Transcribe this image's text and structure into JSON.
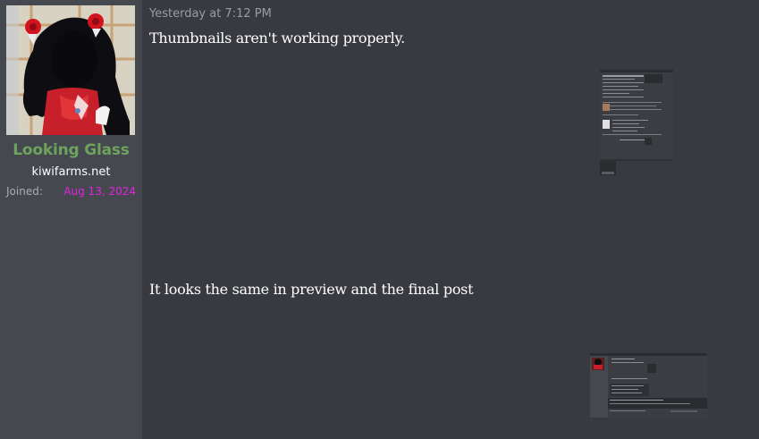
{
  "user": {
    "username": "Looking Glass",
    "title": "kiwifarms.net",
    "joined_label": "Joined:",
    "joined_date": "Aug 13, 2024"
  },
  "message": {
    "timestamp": "Yesterday at 7:12 PM",
    "paragraph1": "Thumbnails aren't working properly.",
    "paragraph2": "It looks the same in preview and the final post"
  },
  "colors": {
    "username": "#6da35c",
    "joined_date": "#e024e0",
    "sidebar_bg": "#45484f",
    "main_bg": "#383a40"
  },
  "icons": {
    "avatar": "avatar-image",
    "attachment1": "screenshot-thumbnail",
    "attachment2": "screenshot-thumbnail"
  }
}
